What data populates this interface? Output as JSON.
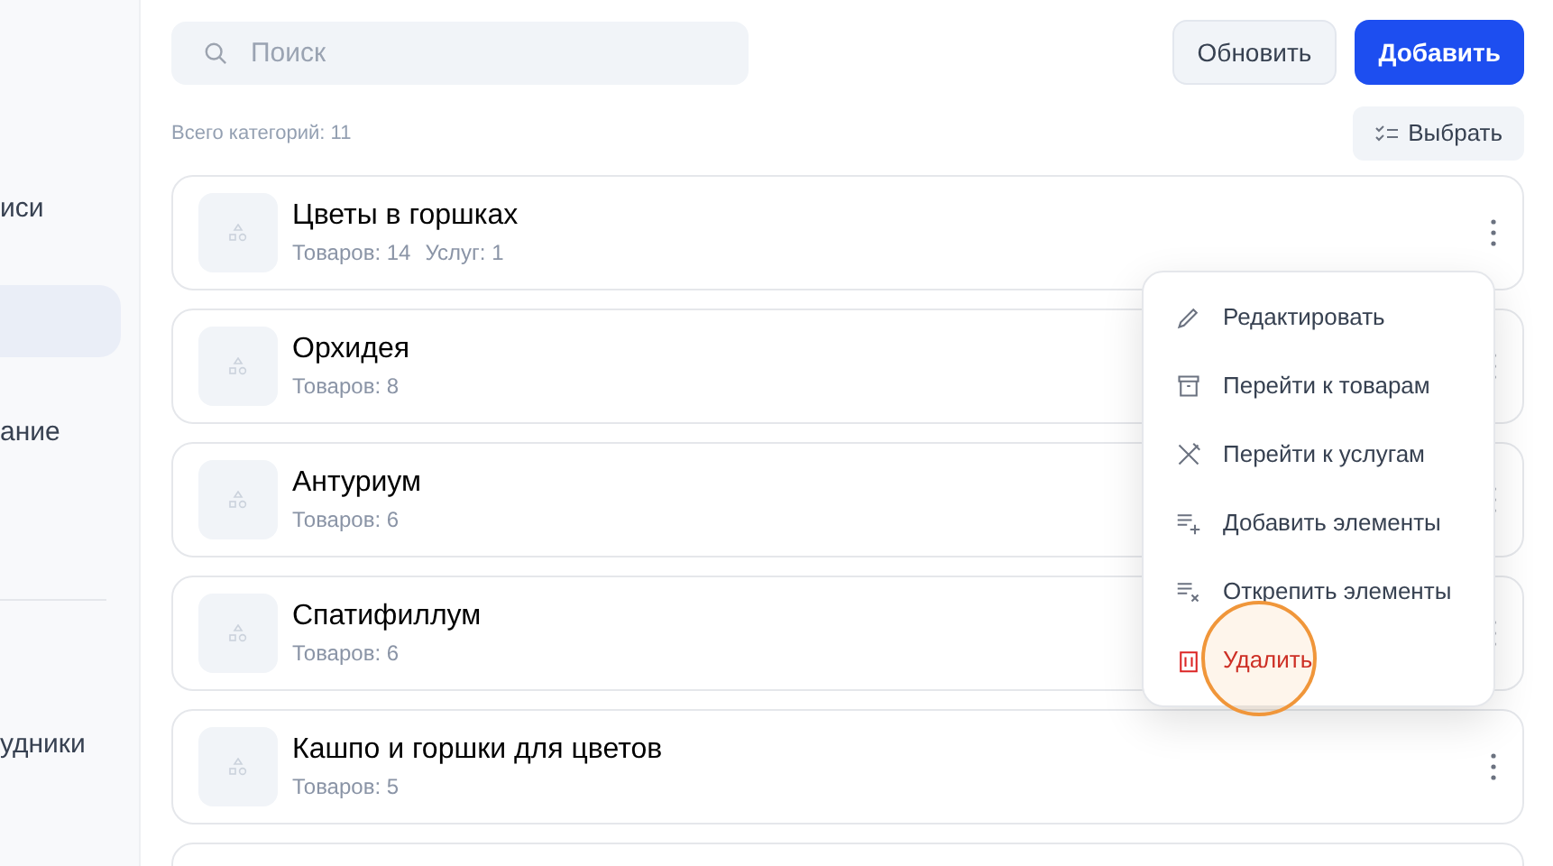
{
  "sidebar": {
    "sections": [
      {
        "items": [
          {
            "label": "иси",
            "selected": false
          },
          {
            "selected": true
          },
          {
            "label": "ание",
            "selected": false
          }
        ]
      },
      {
        "items": [
          {
            "label": "удники",
            "selected": false
          }
        ]
      }
    ]
  },
  "search": {
    "placeholder": "Поиск"
  },
  "buttons": [
    {
      "label": "Обновить",
      "kind": "secondary"
    },
    {
      "label": "Добавить",
      "kind": "primary"
    }
  ],
  "total": "Всего категорий: 11",
  "select_button": {
    "label": "Выбрать"
  },
  "categories": [
    {
      "title": "Цветы в горшках",
      "counts": [
        "Товаров: 14",
        "Услуг: 1"
      ]
    },
    {
      "title": "Орхидея",
      "counts": [
        "Товаров: 8"
      ]
    },
    {
      "title": "Антуриум",
      "counts": [
        "Товаров: 6"
      ]
    },
    {
      "title": "Спатифиллум",
      "counts": [
        "Товаров: 6"
      ]
    },
    {
      "title": "Кашпо и горшки для цветов",
      "counts": [
        "Товаров: 5"
      ]
    }
  ],
  "more_below": true,
  "context_menu": {
    "items": [
      {
        "label": "Редактировать",
        "kind": "normal"
      },
      {
        "label": "Перейти к товарам",
        "kind": "normal"
      },
      {
        "label": "Перейти к услугам",
        "kind": "normal"
      },
      {
        "label": "Добавить элементы",
        "kind": "normal"
      },
      {
        "label": "Открепить элементы",
        "kind": "normal"
      },
      {
        "label": "Удалить",
        "kind": "danger"
      }
    ]
  },
  "tap_indicator": true
}
